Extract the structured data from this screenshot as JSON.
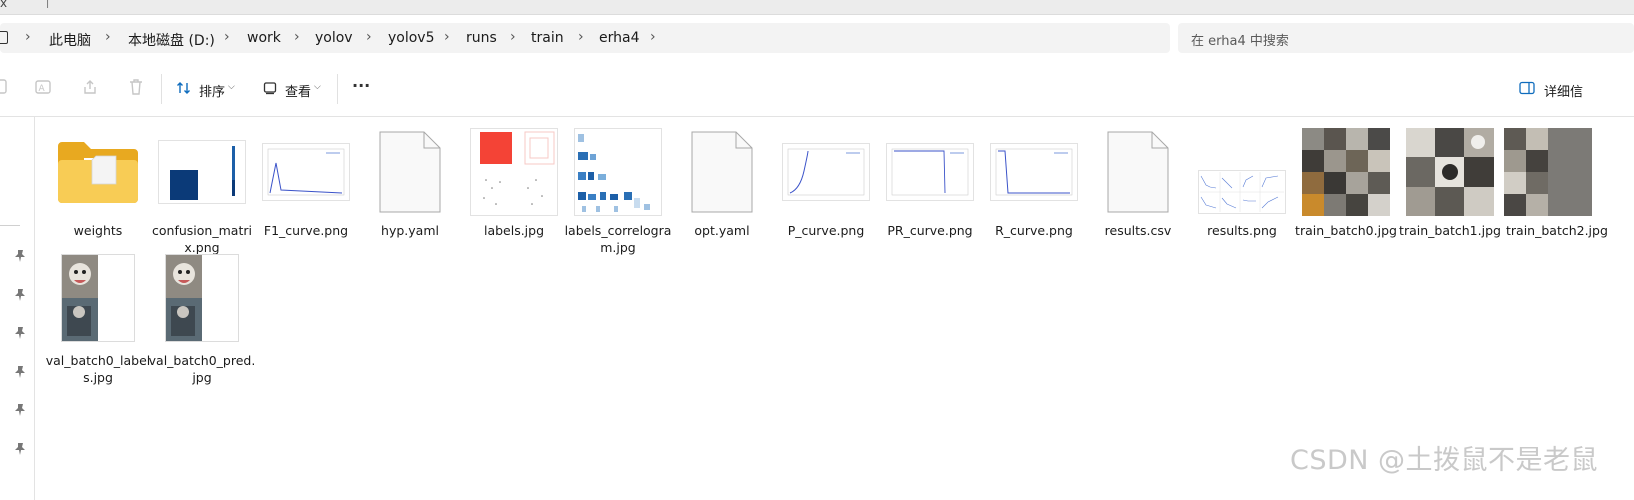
{
  "tabstrip": {
    "close": "x"
  },
  "breadcrumb": [
    "此电脑",
    "本地磁盘 (D:)",
    "work",
    "yolov",
    "yolov5",
    "runs",
    "train",
    "erha4"
  ],
  "search": {
    "placeholder": "在 erha4 中搜索"
  },
  "toolbar": {
    "sort_label": "排序",
    "view_label": "查看",
    "more": "···",
    "details_label": "详细信"
  },
  "files": [
    {
      "name": "weights",
      "icon": "folder-icon"
    },
    {
      "name": "confusion_matrix.png",
      "icon": "image-thumbnail"
    },
    {
      "name": "F1_curve.png",
      "icon": "image-thumbnail"
    },
    {
      "name": "hyp.yaml",
      "icon": "file-icon"
    },
    {
      "name": "labels.jpg",
      "icon": "image-thumbnail"
    },
    {
      "name": "labels_correlogram.jpg",
      "icon": "image-thumbnail"
    },
    {
      "name": "opt.yaml",
      "icon": "file-icon"
    },
    {
      "name": "P_curve.png",
      "icon": "image-thumbnail"
    },
    {
      "name": "PR_curve.png",
      "icon": "image-thumbnail"
    },
    {
      "name": "R_curve.png",
      "icon": "image-thumbnail"
    },
    {
      "name": "results.csv",
      "icon": "file-icon"
    },
    {
      "name": "results.png",
      "icon": "image-thumbnail"
    },
    {
      "name": "train_batch0.jpg",
      "icon": "image-thumbnail"
    },
    {
      "name": "train_batch1.jpg",
      "icon": "image-thumbnail"
    },
    {
      "name": "train_batch2.jpg",
      "icon": "image-thumbnail"
    },
    {
      "name": "val_batch0_labels.jpg",
      "icon": "image-thumbnail"
    },
    {
      "name": "val_batch0_pred.jpg",
      "icon": "image-thumbnail"
    }
  ],
  "watermark": "CSDN @土拨鼠不是老鼠",
  "colors": {
    "folder": "#f6c342",
    "accent": "#0f6cbd",
    "confusion_block": "#0b3a78",
    "label_red": "#f44336"
  }
}
